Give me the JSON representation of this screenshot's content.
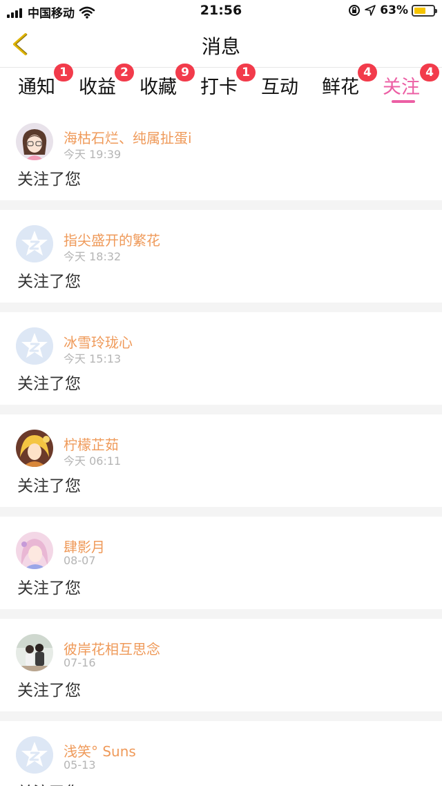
{
  "status_bar": {
    "carrier": "中国移动",
    "time": "21:56",
    "battery_percent": "63%",
    "battery_level": 0.63,
    "icons": [
      "signal-icon",
      "wifi-icon",
      "orientation-lock-icon",
      "location-icon",
      "battery-icon"
    ]
  },
  "header": {
    "title": "消息",
    "back_icon": "back-chevron-icon"
  },
  "tabs": [
    {
      "label": "通知",
      "badge": "1"
    },
    {
      "label": "收益",
      "badge": "2"
    },
    {
      "label": "收藏",
      "badge": "9"
    },
    {
      "label": "打卡",
      "badge": "1"
    },
    {
      "label": "互动",
      "badge": ""
    },
    {
      "label": "鲜花",
      "badge": "4"
    },
    {
      "label": "关注",
      "badge": "4",
      "active": true
    }
  ],
  "colors": {
    "accent": "#ec5fa4",
    "badge": "#f23b4b",
    "username": "#ef9a5a",
    "back_icon": "#e0b400"
  },
  "messages": [
    {
      "user": "海枯石烂、纯属扯蛋i",
      "time": "今天 19:39",
      "text": "关注了您",
      "avatar": "custom"
    },
    {
      "user": "指尖盛开的繁花",
      "time": "今天 18:32",
      "text": "关注了您",
      "avatar": "default"
    },
    {
      "user": "冰雪玲珑心",
      "time": "今天 15:13",
      "text": "关注了您",
      "avatar": "default"
    },
    {
      "user": "柠檬芷茹",
      "time": "今天 06:11",
      "text": "关注了您",
      "avatar": "custom"
    },
    {
      "user": "肆影月",
      "time": "08-07",
      "text": "关注了您",
      "avatar": "custom"
    },
    {
      "user": "彼岸花相互思念",
      "time": "07-16",
      "text": "关注了您",
      "avatar": "custom"
    },
    {
      "user": "浅笑° Suns",
      "time": "05-13",
      "text": "关注了您",
      "avatar": "default"
    }
  ]
}
